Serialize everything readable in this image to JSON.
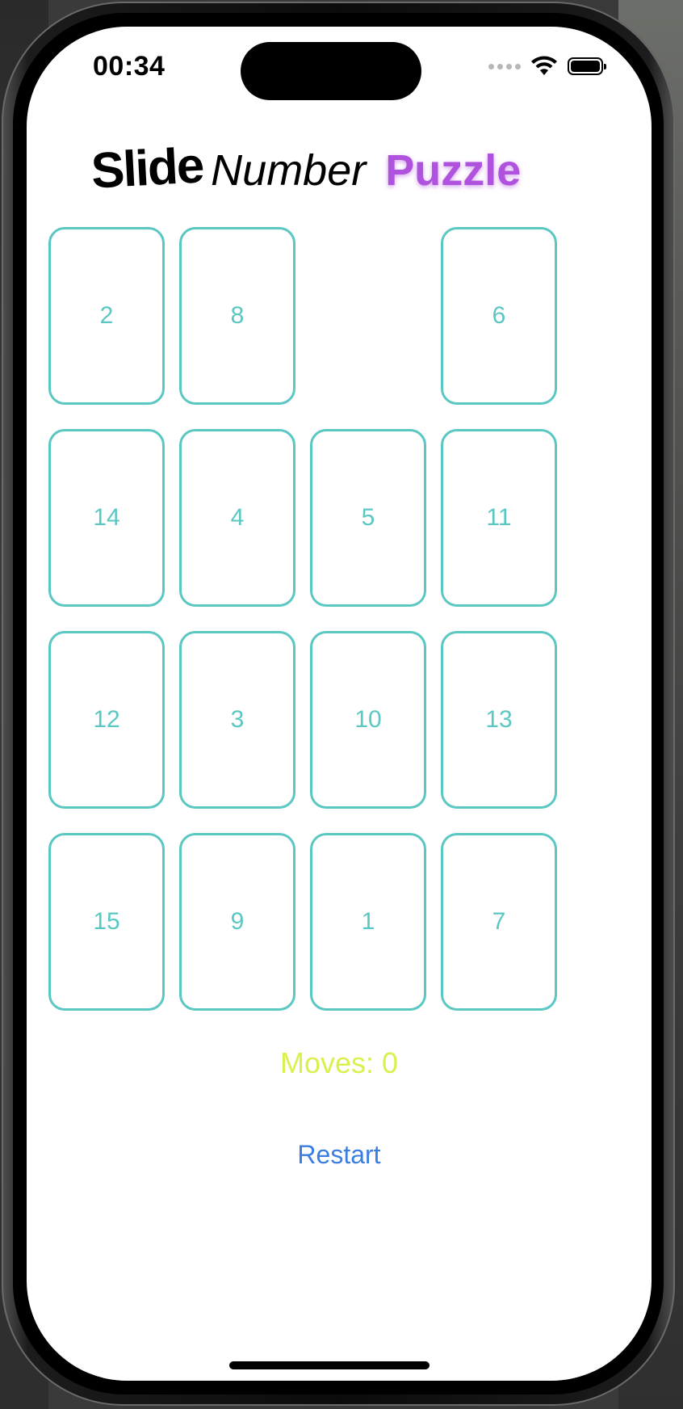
{
  "status_bar": {
    "time": "00:34",
    "icons": [
      "cellular-dots-icon",
      "wifi-icon",
      "battery-icon"
    ]
  },
  "title": {
    "slide": "Slide",
    "number": "Number",
    "puzzle": "Puzzle"
  },
  "colors": {
    "puzzle_accent": "#af52de",
    "tile_border": "#5ac7c3",
    "tile_text": "#5ac7c3",
    "moves_text": "#dbf04d",
    "restart_text": "#3a7ee4"
  },
  "board": {
    "rows": 4,
    "cols": 4,
    "empty_index": 2,
    "tiles": [
      "2",
      "8",
      "",
      "6",
      "14",
      "4",
      "5",
      "11",
      "12",
      "3",
      "10",
      "13",
      "15",
      "9",
      "1",
      "7"
    ]
  },
  "moves": {
    "text": "Moves: 0"
  },
  "restart": {
    "label": "Restart"
  }
}
